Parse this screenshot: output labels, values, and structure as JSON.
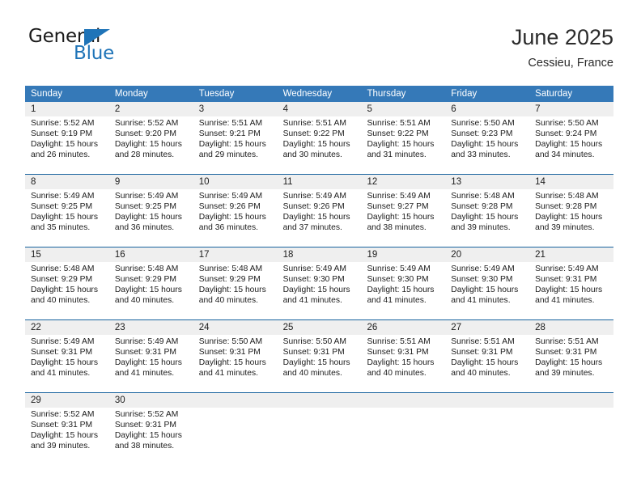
{
  "brand": {
    "name_primary": "General",
    "name_secondary": "Blue",
    "flag_icon": "triangle-flag-icon",
    "accent_color": "#1f74b8"
  },
  "header": {
    "month_title": "June 2025",
    "location": "Cessieu, France"
  },
  "calendar": {
    "header_background": "#3579b8",
    "row_divider_color": "#18639e",
    "daynum_band_color": "#efefef",
    "weekdays": [
      "Sunday",
      "Monday",
      "Tuesday",
      "Wednesday",
      "Thursday",
      "Friday",
      "Saturday"
    ],
    "weeks": [
      [
        {
          "day": "1",
          "lines": [
            "Sunrise: 5:52 AM",
            "Sunset: 9:19 PM",
            "Daylight: 15 hours",
            "and 26 minutes."
          ]
        },
        {
          "day": "2",
          "lines": [
            "Sunrise: 5:52 AM",
            "Sunset: 9:20 PM",
            "Daylight: 15 hours",
            "and 28 minutes."
          ]
        },
        {
          "day": "3",
          "lines": [
            "Sunrise: 5:51 AM",
            "Sunset: 9:21 PM",
            "Daylight: 15 hours",
            "and 29 minutes."
          ]
        },
        {
          "day": "4",
          "lines": [
            "Sunrise: 5:51 AM",
            "Sunset: 9:22 PM",
            "Daylight: 15 hours",
            "and 30 minutes."
          ]
        },
        {
          "day": "5",
          "lines": [
            "Sunrise: 5:51 AM",
            "Sunset: 9:22 PM",
            "Daylight: 15 hours",
            "and 31 minutes."
          ]
        },
        {
          "day": "6",
          "lines": [
            "Sunrise: 5:50 AM",
            "Sunset: 9:23 PM",
            "Daylight: 15 hours",
            "and 33 minutes."
          ]
        },
        {
          "day": "7",
          "lines": [
            "Sunrise: 5:50 AM",
            "Sunset: 9:24 PM",
            "Daylight: 15 hours",
            "and 34 minutes."
          ]
        }
      ],
      [
        {
          "day": "8",
          "lines": [
            "Sunrise: 5:49 AM",
            "Sunset: 9:25 PM",
            "Daylight: 15 hours",
            "and 35 minutes."
          ]
        },
        {
          "day": "9",
          "lines": [
            "Sunrise: 5:49 AM",
            "Sunset: 9:25 PM",
            "Daylight: 15 hours",
            "and 36 minutes."
          ]
        },
        {
          "day": "10",
          "lines": [
            "Sunrise: 5:49 AM",
            "Sunset: 9:26 PM",
            "Daylight: 15 hours",
            "and 36 minutes."
          ]
        },
        {
          "day": "11",
          "lines": [
            "Sunrise: 5:49 AM",
            "Sunset: 9:26 PM",
            "Daylight: 15 hours",
            "and 37 minutes."
          ]
        },
        {
          "day": "12",
          "lines": [
            "Sunrise: 5:49 AM",
            "Sunset: 9:27 PM",
            "Daylight: 15 hours",
            "and 38 minutes."
          ]
        },
        {
          "day": "13",
          "lines": [
            "Sunrise: 5:48 AM",
            "Sunset: 9:28 PM",
            "Daylight: 15 hours",
            "and 39 minutes."
          ]
        },
        {
          "day": "14",
          "lines": [
            "Sunrise: 5:48 AM",
            "Sunset: 9:28 PM",
            "Daylight: 15 hours",
            "and 39 minutes."
          ]
        }
      ],
      [
        {
          "day": "15",
          "lines": [
            "Sunrise: 5:48 AM",
            "Sunset: 9:29 PM",
            "Daylight: 15 hours",
            "and 40 minutes."
          ]
        },
        {
          "day": "16",
          "lines": [
            "Sunrise: 5:48 AM",
            "Sunset: 9:29 PM",
            "Daylight: 15 hours",
            "and 40 minutes."
          ]
        },
        {
          "day": "17",
          "lines": [
            "Sunrise: 5:48 AM",
            "Sunset: 9:29 PM",
            "Daylight: 15 hours",
            "and 40 minutes."
          ]
        },
        {
          "day": "18",
          "lines": [
            "Sunrise: 5:49 AM",
            "Sunset: 9:30 PM",
            "Daylight: 15 hours",
            "and 41 minutes."
          ]
        },
        {
          "day": "19",
          "lines": [
            "Sunrise: 5:49 AM",
            "Sunset: 9:30 PM",
            "Daylight: 15 hours",
            "and 41 minutes."
          ]
        },
        {
          "day": "20",
          "lines": [
            "Sunrise: 5:49 AM",
            "Sunset: 9:30 PM",
            "Daylight: 15 hours",
            "and 41 minutes."
          ]
        },
        {
          "day": "21",
          "lines": [
            "Sunrise: 5:49 AM",
            "Sunset: 9:31 PM",
            "Daylight: 15 hours",
            "and 41 minutes."
          ]
        }
      ],
      [
        {
          "day": "22",
          "lines": [
            "Sunrise: 5:49 AM",
            "Sunset: 9:31 PM",
            "Daylight: 15 hours",
            "and 41 minutes."
          ]
        },
        {
          "day": "23",
          "lines": [
            "Sunrise: 5:49 AM",
            "Sunset: 9:31 PM",
            "Daylight: 15 hours",
            "and 41 minutes."
          ]
        },
        {
          "day": "24",
          "lines": [
            "Sunrise: 5:50 AM",
            "Sunset: 9:31 PM",
            "Daylight: 15 hours",
            "and 41 minutes."
          ]
        },
        {
          "day": "25",
          "lines": [
            "Sunrise: 5:50 AM",
            "Sunset: 9:31 PM",
            "Daylight: 15 hours",
            "and 40 minutes."
          ]
        },
        {
          "day": "26",
          "lines": [
            "Sunrise: 5:51 AM",
            "Sunset: 9:31 PM",
            "Daylight: 15 hours",
            "and 40 minutes."
          ]
        },
        {
          "day": "27",
          "lines": [
            "Sunrise: 5:51 AM",
            "Sunset: 9:31 PM",
            "Daylight: 15 hours",
            "and 40 minutes."
          ]
        },
        {
          "day": "28",
          "lines": [
            "Sunrise: 5:51 AM",
            "Sunset: 9:31 PM",
            "Daylight: 15 hours",
            "and 39 minutes."
          ]
        }
      ],
      [
        {
          "day": "29",
          "lines": [
            "Sunrise: 5:52 AM",
            "Sunset: 9:31 PM",
            "Daylight: 15 hours",
            "and 39 minutes."
          ]
        },
        {
          "day": "30",
          "lines": [
            "Sunrise: 5:52 AM",
            "Sunset: 9:31 PM",
            "Daylight: 15 hours",
            "and 38 minutes."
          ]
        },
        {
          "day": "",
          "lines": []
        },
        {
          "day": "",
          "lines": []
        },
        {
          "day": "",
          "lines": []
        },
        {
          "day": "",
          "lines": []
        },
        {
          "day": "",
          "lines": []
        }
      ]
    ]
  }
}
